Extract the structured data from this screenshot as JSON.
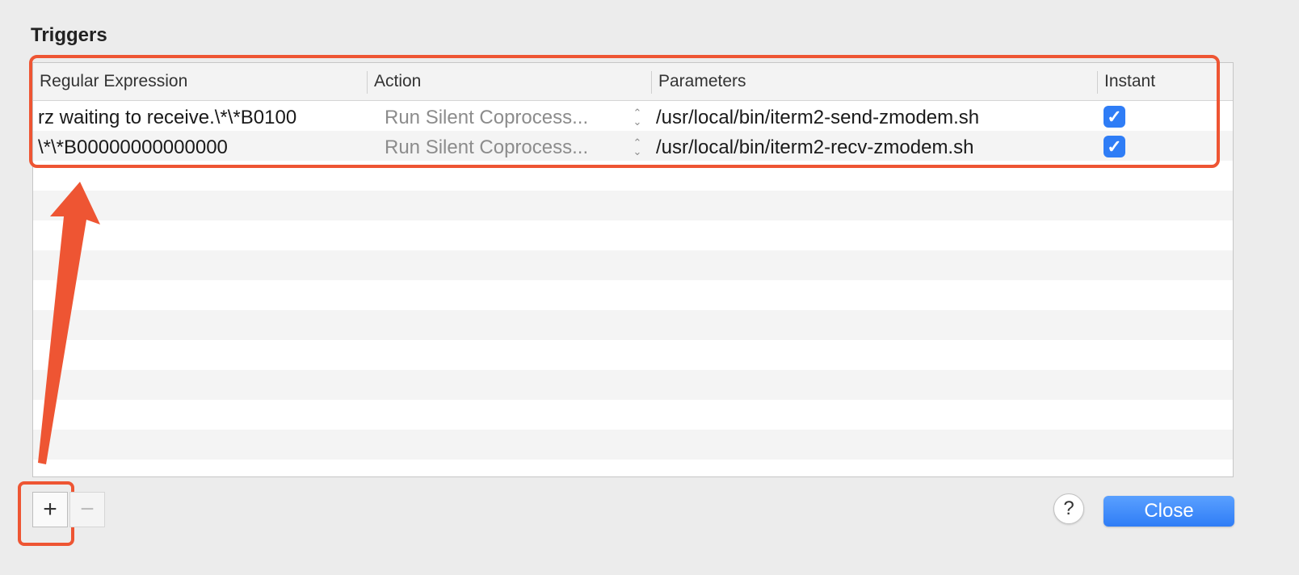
{
  "section_title": "Triggers",
  "columns": [
    "Regular Expression",
    "Action",
    "Parameters",
    "Instant"
  ],
  "rows": [
    {
      "regex": "rz waiting to receive.\\*\\*B0100",
      "action": "Run Silent Coprocess...",
      "parameters": "/usr/local/bin/iterm2-send-zmodem.sh",
      "instant": true
    },
    {
      "regex": "\\*\\*B00000000000000",
      "action": "Run Silent Coprocess...",
      "parameters": "/usr/local/bin/iterm2-recv-zmodem.sh",
      "instant": true
    }
  ],
  "buttons": {
    "add": "+",
    "remove": "−",
    "help": "?",
    "close": "Close"
  },
  "colors": {
    "accent": "#2f7df6",
    "annotation": "#ee5533"
  }
}
